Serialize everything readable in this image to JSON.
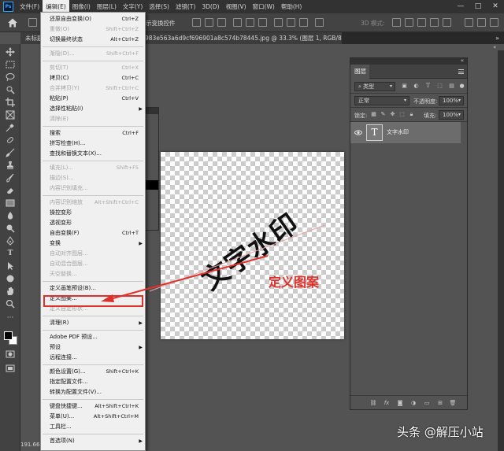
{
  "app": {
    "logo": "Ps"
  },
  "menubar": {
    "items": [
      "文件(F)",
      "编辑(E)",
      "图像(I)",
      "图层(L)",
      "文字(Y)",
      "选择(S)",
      "滤镜(T)",
      "3D(D)",
      "视图(V)",
      "窗口(W)",
      "帮助(H)"
    ],
    "active_index": 1,
    "window_controls": [
      "—",
      "□",
      "✕"
    ]
  },
  "options_bar": {
    "text": "示变换控件",
    "mode_3d": "3D 模式:"
  },
  "tabs": {
    "untitled": "未标题",
    "active": "983e563a6d9cf696901a8c574b78445.jpg @ 33.3% (图层 1, RGB/8) *",
    "overflow": "»"
  },
  "edit_menu": {
    "groups": [
      [
        {
          "label": "还原自由变换(O)",
          "shortcut": "Ctrl+Z",
          "disabled": false
        },
        {
          "label": "重做(O)",
          "shortcut": "Shift+Ctrl+Z",
          "disabled": true
        },
        {
          "label": "切换最终状态",
          "shortcut": "Alt+Ctrl+Z",
          "disabled": false
        }
      ],
      [
        {
          "label": "渐隐(D)...",
          "shortcut": "Shift+Ctrl+F",
          "disabled": true
        }
      ],
      [
        {
          "label": "剪切(T)",
          "shortcut": "Ctrl+X",
          "disabled": true
        },
        {
          "label": "拷贝(C)",
          "shortcut": "Ctrl+C",
          "disabled": false
        },
        {
          "label": "合并拷贝(Y)",
          "shortcut": "Shift+Ctrl+C",
          "disabled": true
        },
        {
          "label": "粘贴(P)",
          "shortcut": "Ctrl+V",
          "disabled": false
        },
        {
          "label": "选择性粘贴(I)",
          "shortcut": "",
          "disabled": false,
          "submenu": true
        },
        {
          "label": "清除(E)",
          "shortcut": "",
          "disabled": true
        }
      ],
      [
        {
          "label": "搜索",
          "shortcut": "Ctrl+F",
          "disabled": false
        },
        {
          "label": "拼写检查(H)...",
          "shortcut": "",
          "disabled": false
        },
        {
          "label": "查找和替换文本(X)...",
          "shortcut": "",
          "disabled": false
        }
      ],
      [
        {
          "label": "填充(L)...",
          "shortcut": "Shift+F5",
          "disabled": true
        },
        {
          "label": "描边(S)...",
          "shortcut": "",
          "disabled": true
        },
        {
          "label": "内容识别填充...",
          "shortcut": "",
          "disabled": true
        }
      ],
      [
        {
          "label": "内容识别缩放",
          "shortcut": "Alt+Shift+Ctrl+C",
          "disabled": true
        },
        {
          "label": "操控变形",
          "shortcut": "",
          "disabled": false
        },
        {
          "label": "透视变形",
          "shortcut": "",
          "disabled": false
        },
        {
          "label": "自由变换(F)",
          "shortcut": "Ctrl+T",
          "disabled": false
        },
        {
          "label": "变换",
          "shortcut": "",
          "disabled": false,
          "submenu": true
        },
        {
          "label": "自动对齐图层...",
          "shortcut": "",
          "disabled": true
        },
        {
          "label": "自动混合图层...",
          "shortcut": "",
          "disabled": true
        },
        {
          "label": "天空替换...",
          "shortcut": "",
          "disabled": true
        }
      ],
      [
        {
          "label": "定义画笔预设(B)...",
          "shortcut": "",
          "disabled": false
        },
        {
          "label": "定义图案...",
          "shortcut": "",
          "disabled": false
        },
        {
          "label": "定义自定形状...",
          "shortcut": "",
          "disabled": true
        }
      ],
      [
        {
          "label": "清理(R)",
          "shortcut": "",
          "disabled": false,
          "submenu": true
        }
      ],
      [
        {
          "label": "Adobe PDF 预设...",
          "shortcut": "",
          "disabled": false
        },
        {
          "label": "预设",
          "shortcut": "",
          "disabled": false,
          "submenu": true
        },
        {
          "label": "远程连接...",
          "shortcut": "",
          "disabled": false
        }
      ],
      [
        {
          "label": "颜色设置(G)...",
          "shortcut": "Shift+Ctrl+K",
          "disabled": false
        },
        {
          "label": "指定配置文件...",
          "shortcut": "",
          "disabled": false
        },
        {
          "label": "转换为配置文件(V)...",
          "shortcut": "",
          "disabled": false
        }
      ],
      [
        {
          "label": "键盘快捷键...",
          "shortcut": "Alt+Shift+Ctrl+K",
          "disabled": false
        },
        {
          "label": "菜单(U)...",
          "shortcut": "Alt+Shift+Ctrl+M",
          "disabled": false
        },
        {
          "label": "工具栏...",
          "shortcut": "",
          "disabled": false
        }
      ],
      [
        {
          "label": "首选项(N)",
          "shortcut": "",
          "disabled": false,
          "submenu": true
        }
      ]
    ],
    "highlighted_label": "定义图案..."
  },
  "canvas": {
    "watermark_text": "文字水印"
  },
  "annotation": {
    "label": "定义图案",
    "color": "#e0302b"
  },
  "layers_panel": {
    "title": "图层",
    "filter_kind": "类型",
    "blend_mode": "正常",
    "opacity_label": "不透明度:",
    "opacity_value": "100%",
    "lock_label": "锁定:",
    "fill_label": "填充:",
    "fill_value": "100%",
    "layers": [
      {
        "name": "文字水印",
        "thumb": "T",
        "visible": true
      }
    ],
    "footer_icons": [
      "link-icon",
      "fx-icon",
      "mask-icon",
      "adjustment-icon",
      "folder-icon",
      "new-layer-icon",
      "trash-icon"
    ],
    "fx_label": "fx"
  },
  "status": {
    "zoom": "191.66"
  },
  "site_label": "头条 @解压小站"
}
